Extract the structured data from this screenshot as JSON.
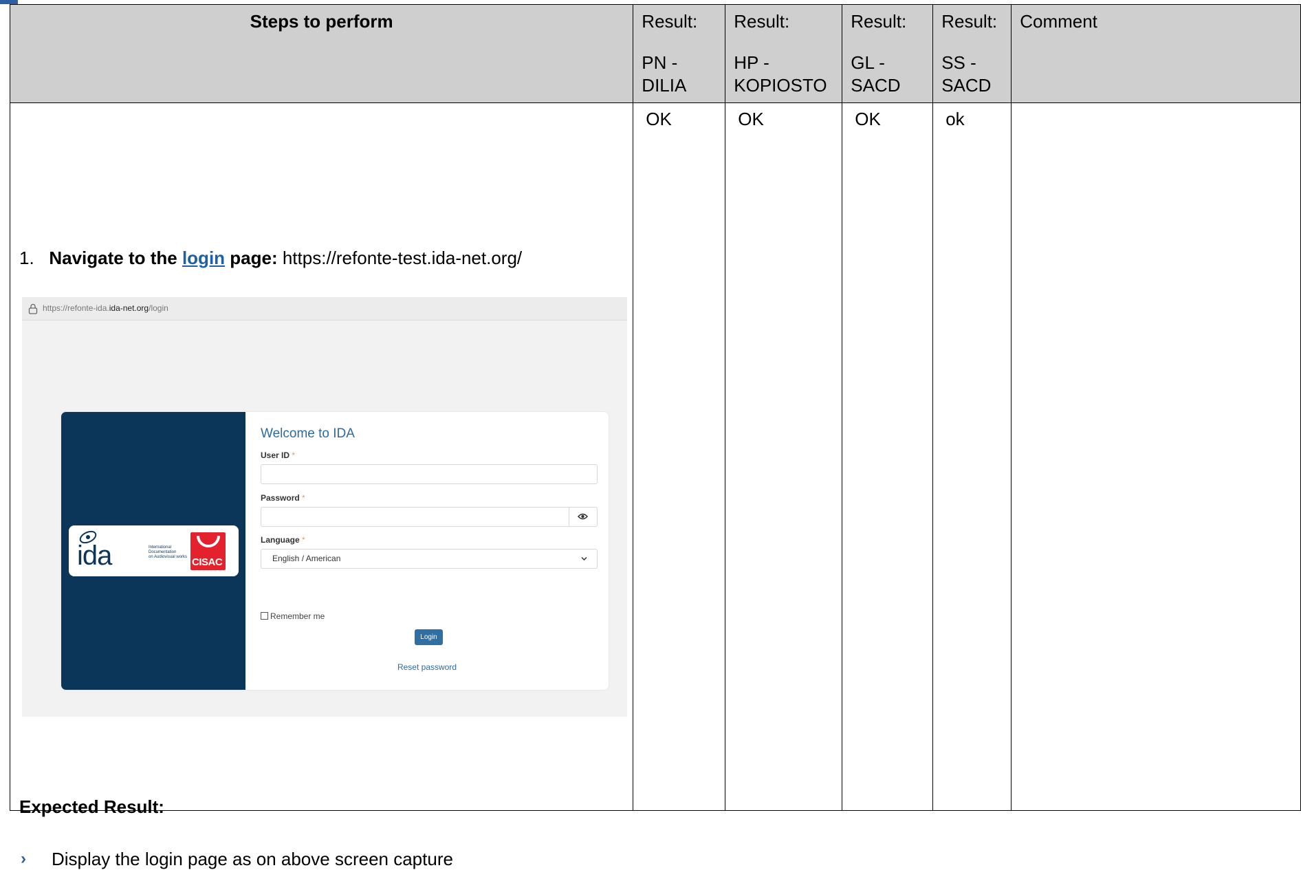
{
  "table": {
    "headers": {
      "steps": "Steps to perform",
      "result_label": "Result:",
      "comment": "Comment",
      "columns": [
        {
          "line1": "PN -",
          "line2": "DILIA"
        },
        {
          "line1": "HP -",
          "line2": "KOPIOSTO"
        },
        {
          "line1": "GL -",
          "line2": "SACD"
        },
        {
          "line1": "SS -",
          "line2": "SACD"
        }
      ]
    },
    "results": [
      "OK",
      "OK",
      "OK",
      "ok"
    ]
  },
  "step": {
    "number": "1.",
    "prefix": "Navigate to the ",
    "link": "login",
    "suffix": " page:",
    "url": " https://refonte-test.ida-net.org/"
  },
  "screenshot": {
    "url_prefix": "https://refonte-ida.",
    "url_host": "ida-net.org",
    "url_path": "/login",
    "logo": {
      "word": "ida",
      "tagline": [
        "International",
        "Documentation",
        "on Audiovisual works"
      ],
      "partner": "CISAC"
    },
    "welcome": "Welcome to IDA",
    "user_id_label": "User ID",
    "password_label": "Password",
    "language_label": "Language",
    "required_mark": "*",
    "language_value": "English / American",
    "remember_me": "Remember me",
    "login_button": "Login",
    "reset_password": "Reset password",
    "icons": {
      "lock": "lock-icon",
      "eye": "eye-icon",
      "chevron": "chevron-down-icon"
    }
  },
  "expected": {
    "label": "Expected Result:",
    "bullet": "›",
    "text": "Display the login page as on above screen capture"
  },
  "colors": {
    "header_bg": "#cfcfcf",
    "link": "#1f5fa8",
    "brand_navy": "#0c3659",
    "cisac_red": "#e4222e",
    "accent_blue": "#2c6aa0"
  }
}
